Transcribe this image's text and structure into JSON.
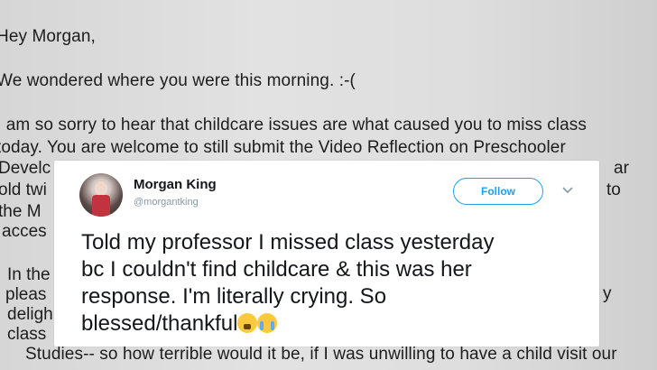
{
  "email": {
    "line1": "Hey Morgan,",
    "line2": "We wondered where you were this morning. :-(",
    "line3": "I am so sorry to hear that childcare issues are what caused you to miss class",
    "line4": "today. You are welcome to still submit the Video Reflection on Preschooler",
    "frag_develc": "Develc",
    "frag_ar": "ar",
    "frag_oldtwi": "old twi",
    "frag_to": "to",
    "frag_them": "the M",
    "frag_acces": "acces",
    "frag_inthe": "In the",
    "frag_pleas": "pleas",
    "frag_delig": "deligh",
    "frag_class": "class",
    "frag_y": "y",
    "bottom_line": "Studies-- so how terrible would it be, if I was unwilling to have a child visit our"
  },
  "tweet": {
    "name": "Morgan King",
    "handle": "@morgantking",
    "follow_label": "Follow",
    "text_line1": "Told my professor I missed class yesterday",
    "text_line2": "bc I couldn't find childcare & this was her",
    "text_line3": "response. I'm literally crying. So",
    "text_line4": "blessed/thankful",
    "accent_color": "#1da1f2",
    "emojis": [
      "weary-face-icon",
      "loudly-crying-face-icon"
    ]
  }
}
